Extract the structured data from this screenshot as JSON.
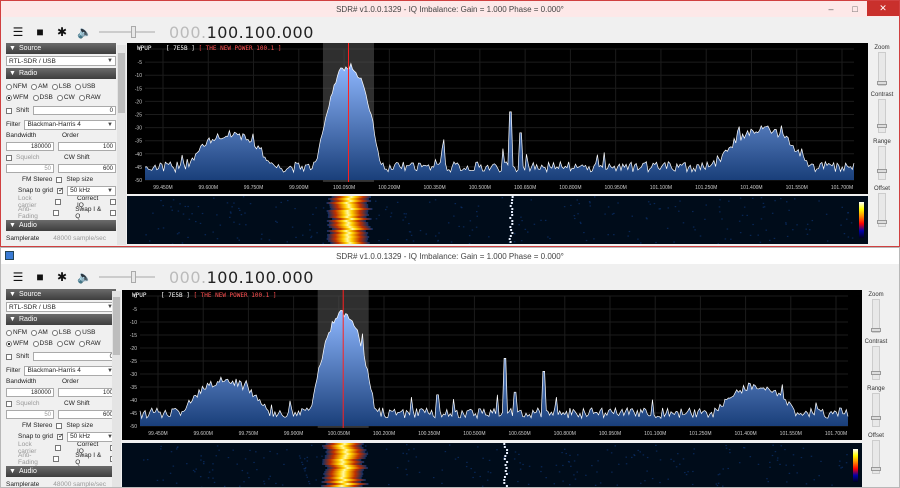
{
  "window": {
    "title": "SDR# v1.0.0.1329 - IQ Imbalance: Gain = 1.000 Phase = 0.000°",
    "min": "–",
    "max": "□",
    "close": "✕"
  },
  "toolbar": {
    "menu_icon": "☰",
    "stop_icon": "■",
    "settings_icon": "✱",
    "volume_icon": "🔈",
    "freq_dim": "000.",
    "freq_main": "100.100.000",
    "volume": 0.6
  },
  "panel": {
    "source_header": "Source",
    "source_value": "RTL-SDR / USB",
    "radio_header": "Radio",
    "modes_row1": [
      "NFM",
      "AM",
      "LSB",
      "USB"
    ],
    "modes_row2": [
      "WFM",
      "DSB",
      "CW",
      "RAW"
    ],
    "selected_mode": "WFM",
    "shift_label": "Shift",
    "shift_value": "0",
    "filter_label": "Filter",
    "filter_value": "Blackman-Harris 4",
    "bandwidth_label": "Bandwidth",
    "order_label": "Order",
    "bandwidth_value": "180000",
    "order_value": "100",
    "squelch_label": "Squelch",
    "cw_shift_label": "CW Shift",
    "squelch_value": "50",
    "cw_shift_value": "600",
    "fm_stereo_label": "FM Stereo",
    "step_size_label": "Step size",
    "snap_label": "Snap to grid",
    "step_value": "50 kHz",
    "lock_carrier_label": "Lock carrier",
    "correct_iq_label": "Correct IQ",
    "anti_fading_label": "Anti-Fading",
    "swap_iq_label": "Swap I & Q",
    "audio_header": "Audio",
    "samplerate_label": "Samplerate",
    "samplerate_value": "48000 sample/sec"
  },
  "spectrum": {
    "station_id": "WPUP",
    "pi_code": "[ 7E5B ]",
    "radiotext": "[ THE NEW POWER 100.1 ]",
    "y_labels": [
      "0",
      "-5",
      "-10",
      "-15",
      "-20",
      "-25",
      "-30",
      "-35",
      "-40",
      "-45",
      "-50"
    ],
    "x_labels": [
      "99.450M",
      "99.600M",
      "99.750M",
      "99.900M",
      "100.050M",
      "100.200M",
      "100.350M",
      "100.500M",
      "100.650M",
      "100.800M",
      "100.950M",
      "101.100M",
      "101.250M",
      "101.400M",
      "101.550M",
      "101.700M"
    ]
  },
  "right_controls": {
    "zoom": "Zoom",
    "contrast": "Contrast",
    "range": "Range",
    "offset": "Offset"
  },
  "colors": {
    "spectrum_bg": "#000000",
    "trace": "#ffffff",
    "fill": "#3c78c8",
    "center_line": "#ff2020",
    "filter_band": "#555555",
    "title_active": "#c9302c"
  }
}
